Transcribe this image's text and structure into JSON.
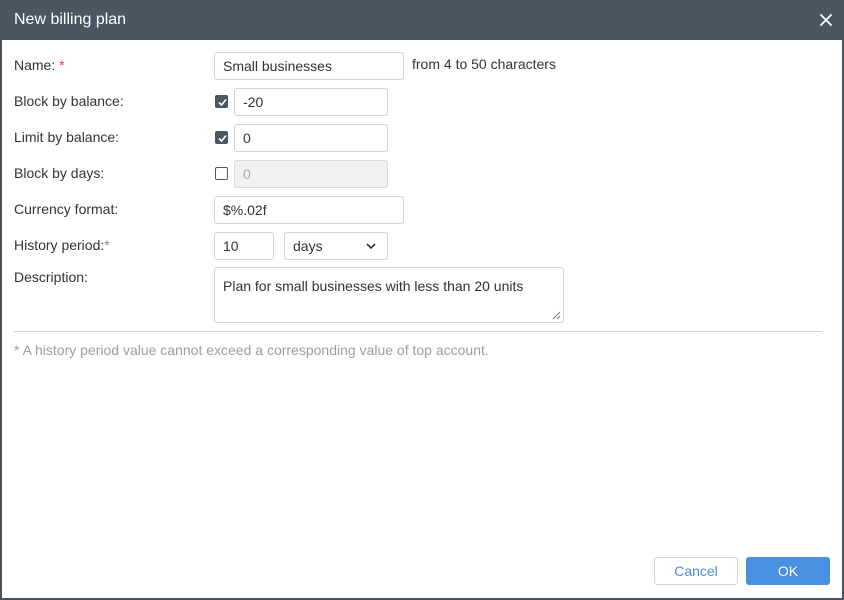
{
  "dialog": {
    "title": "New billing plan",
    "close_icon": "close-icon"
  },
  "form": {
    "name": {
      "label": "Name:",
      "required_mark": "*",
      "value": "Small businesses",
      "hint": "from 4 to 50 characters"
    },
    "block_by_balance": {
      "label": "Block by balance:",
      "checked": true,
      "value": "-20"
    },
    "limit_by_balance": {
      "label": "Limit by balance:",
      "checked": true,
      "value": "0"
    },
    "block_by_days": {
      "label": "Block by days:",
      "checked": false,
      "value": "0",
      "disabled": true
    },
    "currency_format": {
      "label": "Currency format:",
      "value": "$%.02f"
    },
    "history_period": {
      "label": "History period:",
      "required_mark": "*",
      "value": "10",
      "unit": "days",
      "unit_icon": "chevron-down-icon"
    },
    "description": {
      "label": "Description:",
      "value": "Plan for small businesses with less than 20 units"
    }
  },
  "footnote": "* A history period value cannot exceed a corresponding value of top account.",
  "buttons": {
    "cancel": "Cancel",
    "ok": "OK"
  },
  "colors": {
    "titlebar": "#4b5663",
    "accent": "#4a90e2",
    "required": "#e53935"
  }
}
